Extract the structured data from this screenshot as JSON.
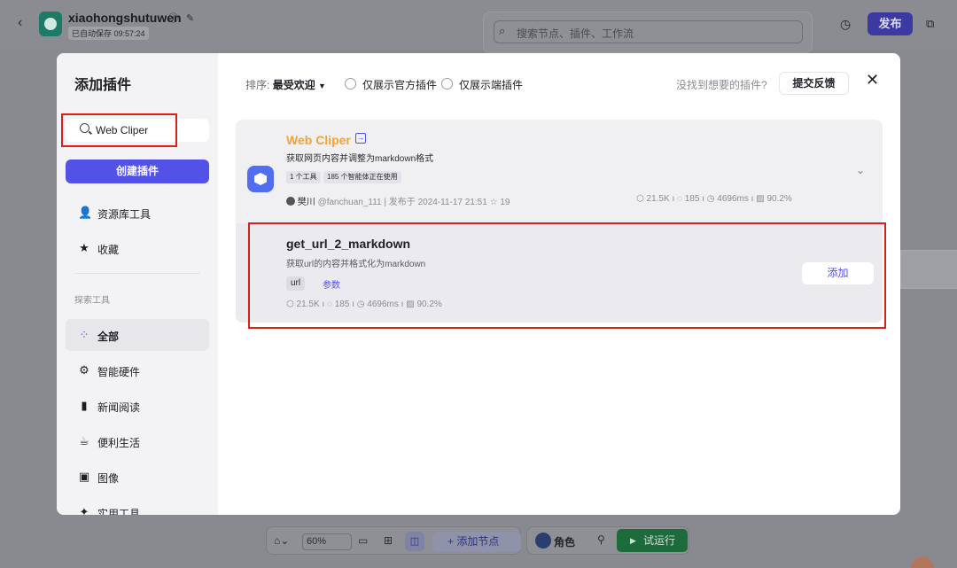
{
  "app": {
    "title": "xiaohongshutuwen",
    "autosave": "已自动保存 09:57:24",
    "search_placeholder": "搜索节点、插件、工作流",
    "publish_label": "发布"
  },
  "bottom_toolbar": {
    "zoom": "60%",
    "add_node_label": "+ 添加节点",
    "role_label": "角色",
    "run_label": "试运行"
  },
  "modal": {
    "title": "添加插件",
    "search_value": "Web Cliper",
    "create_label": "创建插件",
    "nav_top": [
      {
        "label": "资源库工具",
        "icon": "user-icon"
      },
      {
        "label": "收藏",
        "icon": "star-icon"
      }
    ],
    "section_label": "探索工具",
    "nav_categories": [
      {
        "label": "全部",
        "icon": "grid-icon"
      },
      {
        "label": "智能硬件",
        "icon": "chip-icon"
      },
      {
        "label": "新闻阅读",
        "icon": "book-icon"
      },
      {
        "label": "便利生活",
        "icon": "cup-icon"
      },
      {
        "label": "图像",
        "icon": "image-icon"
      },
      {
        "label": "实用工具",
        "icon": "tool-icon"
      }
    ],
    "filter": {
      "sort_label": "排序:",
      "sort_value": "最受欢迎",
      "official_only": "仅展示官方插件",
      "client_only": "仅展示端插件"
    },
    "not_found": "没找到想要的插件?",
    "feedback_label": "提交反馈",
    "close_glyph": "✕",
    "plugin": {
      "name": "Web Cliper",
      "description": "获取网页内容并调整为markdown格式",
      "tags": [
        "1 个工具",
        "185 个智能体正在使用"
      ],
      "author": "樊川",
      "handle": "@fanchuan_111",
      "published": "发布于 2024-11-17 21:51",
      "stars": "19",
      "stat_calls": "21.5K",
      "stat_bots": "185",
      "stat_latency": "4696ms",
      "stat_success": "90.2%"
    },
    "tool": {
      "name": "get_url_2_markdown",
      "description": "获取url的内容并格式化为markdown",
      "tag": "url",
      "params_label": "参数",
      "stat_calls": "21.5K",
      "stat_bots": "185",
      "stat_latency": "4696ms",
      "stat_success": "90.2%",
      "add_label": "添加"
    }
  },
  "colors": {
    "accent": "#5352e6",
    "plugin_name": "#f1a33b",
    "highlight": "#d8201a",
    "run_green": "#1b6b3b"
  }
}
